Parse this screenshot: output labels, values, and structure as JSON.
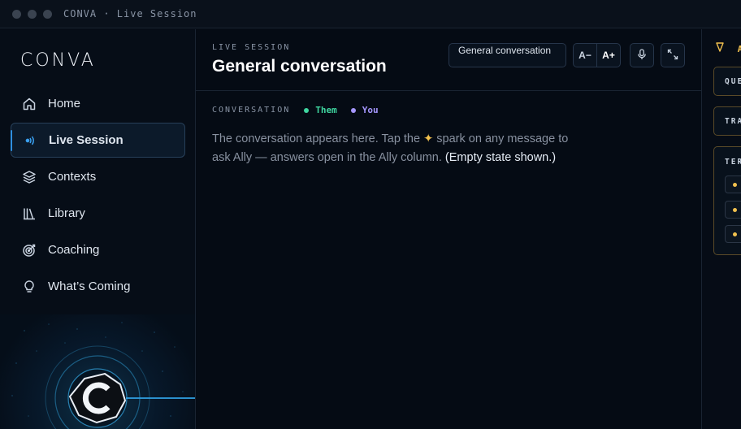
{
  "window": {
    "title": "CONVA · Live Session"
  },
  "sidebar": {
    "logo": "CONVA",
    "items": [
      {
        "label": "Home",
        "icon": "home-icon",
        "active": false
      },
      {
        "label": "Live Session",
        "icon": "live-signal-icon",
        "active": true
      },
      {
        "label": "Contexts",
        "icon": "layers-icon",
        "active": false
      },
      {
        "label": "Library",
        "icon": "library-icon",
        "active": false
      },
      {
        "label": "Coaching",
        "icon": "target-icon",
        "active": false
      },
      {
        "label": "What’s Coming",
        "icon": "lightbulb-icon",
        "active": false
      }
    ]
  },
  "header": {
    "eyebrow": "LIVE SESSION",
    "title": "General conversation",
    "context_select": "General conversation",
    "font_decrease": "A−",
    "font_increase": "A+"
  },
  "conversation": {
    "label": "CONVERSATION",
    "legend": [
      {
        "label": "Them",
        "color": "#3fd6a0"
      },
      {
        "label": "You",
        "color": "#a597ff"
      }
    ],
    "empty_text_1": "The conversation appears here. Tap the",
    "spark_glyph": "✦",
    "empty_text_2": "spark on any message to ask Ally — answers open in the Ally column.",
    "empty_note": "(Empty state shown.)"
  },
  "ally_panel": {
    "header": "A",
    "cards": [
      "QUE",
      "TRA",
      "TER"
    ]
  },
  "colors": {
    "accent": "#2f8fe0",
    "gold": "#f2c14e",
    "background": "#050b14"
  }
}
